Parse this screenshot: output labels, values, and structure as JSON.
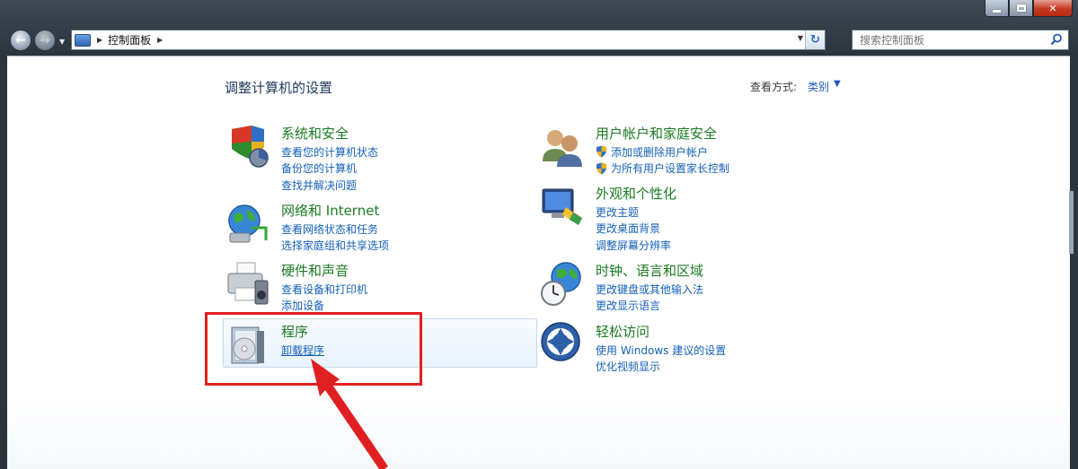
{
  "address": {
    "path": "控制面板"
  },
  "search": {
    "placeholder": "搜索控制面板"
  },
  "page": {
    "title": "调整计算机的设置",
    "view_by_label": "查看方式:",
    "view_by_value": "类别"
  },
  "categories": [
    {
      "title": "系统和安全",
      "links": [
        "查看您的计算机状态",
        "备份您的计算机",
        "查找并解决问题"
      ]
    },
    {
      "title": "网络和 Internet",
      "links": [
        "查看网络状态和任务",
        "选择家庭组和共享选项"
      ]
    },
    {
      "title": "硬件和声音",
      "links": [
        "查看设备和打印机",
        "添加设备"
      ]
    },
    {
      "title": "程序",
      "links": [
        "卸载程序"
      ]
    },
    {
      "title": "用户帐户和家庭安全",
      "links": [
        "添加或删除用户帐户",
        "为所有用户设置家长控制"
      ]
    },
    {
      "title": "外观和个性化",
      "links": [
        "更改主题",
        "更改桌面背景",
        "调整屏幕分辨率"
      ]
    },
    {
      "title": "时钟、语言和区域",
      "links": [
        "更改键盘或其他输入法",
        "更改显示语言"
      ]
    },
    {
      "title": "轻松访问",
      "links": [
        "使用 Windows 建议的设置",
        "优化视频显示"
      ]
    }
  ],
  "colors": {
    "category_title": "#1c7a23",
    "link": "#1560b8",
    "annotation": "#e02020"
  }
}
